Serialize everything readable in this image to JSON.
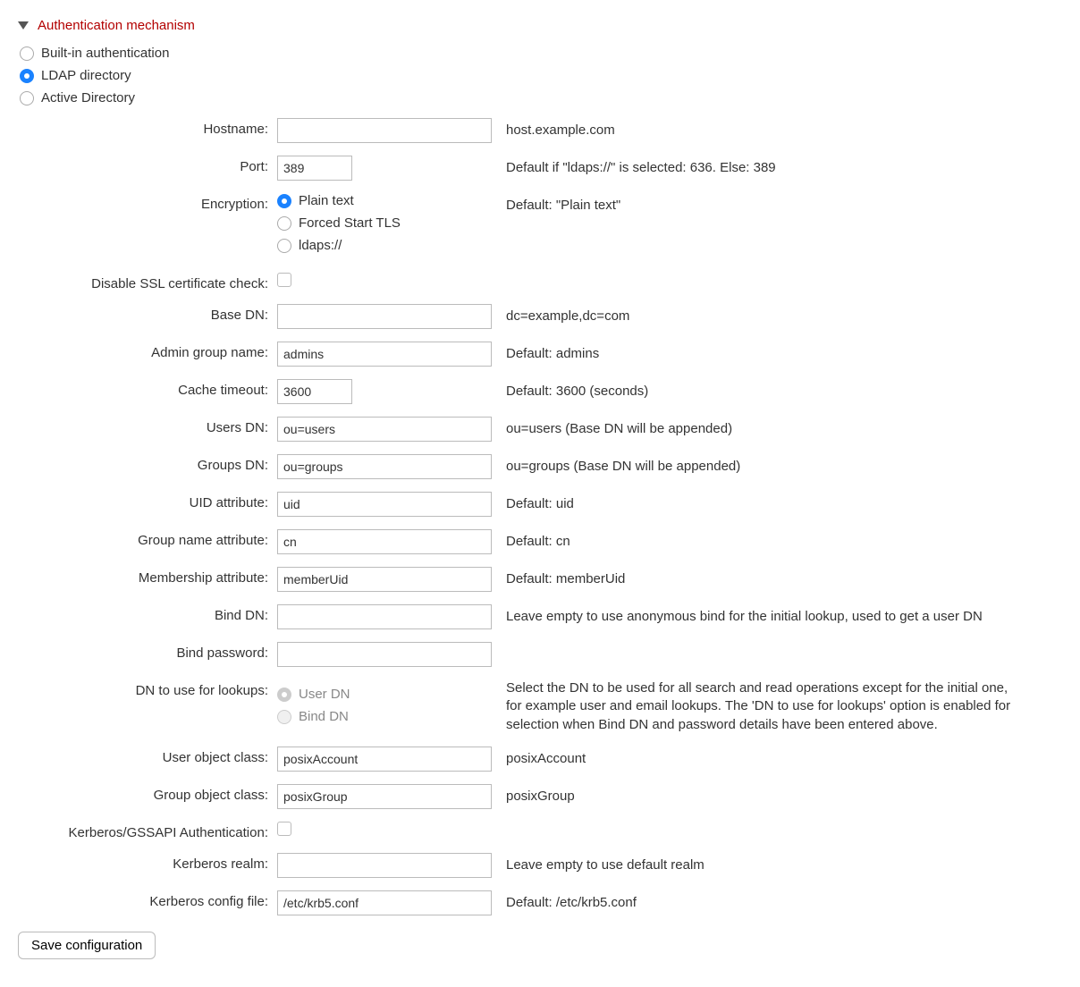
{
  "section": {
    "title": "Authentication mechanism"
  },
  "auth_type": {
    "builtin": "Built-in authentication",
    "ldap": "LDAP directory",
    "ad": "Active Directory",
    "selected": "ldap"
  },
  "labels": {
    "hostname": "Hostname:",
    "port": "Port:",
    "encryption": "Encryption:",
    "disable_ssl": "Disable SSL certificate check:",
    "base_dn": "Base DN:",
    "admin_group": "Admin group name:",
    "cache_timeout": "Cache timeout:",
    "users_dn": "Users DN:",
    "groups_dn": "Groups DN:",
    "uid_attr": "UID attribute:",
    "group_name_attr": "Group name attribute:",
    "membership_attr": "Membership attribute:",
    "bind_dn": "Bind DN:",
    "bind_password": "Bind password:",
    "dn_lookups": "DN to use for lookups:",
    "user_obj_class": "User object class:",
    "group_obj_class": "Group object class:",
    "kerberos_auth": "Kerberos/GSSAPI Authentication:",
    "kerberos_realm": "Kerberos realm:",
    "kerberos_config": "Kerberos config file:"
  },
  "values": {
    "hostname": "",
    "port": "389",
    "base_dn": "",
    "admin_group": "admins",
    "cache_timeout": "3600",
    "users_dn": "ou=users",
    "groups_dn": "ou=groups",
    "uid_attr": "uid",
    "group_name_attr": "cn",
    "membership_attr": "memberUid",
    "bind_dn": "",
    "bind_password": "",
    "user_obj_class": "posixAccount",
    "group_obj_class": "posixGroup",
    "kerberos_realm": "",
    "kerberos_config": "/etc/krb5.conf"
  },
  "encryption": {
    "plain": "Plain text",
    "tls": "Forced Start TLS",
    "ldaps": "ldaps://",
    "selected": "plain"
  },
  "dn_lookup": {
    "user": "User DN",
    "bind": "Bind DN",
    "selected": "user"
  },
  "hints": {
    "hostname": "host.example.com",
    "port": "Default if \"ldaps://\" is selected: 636. Else: 389",
    "encryption": "Default: \"Plain text\"",
    "base_dn": "dc=example,dc=com",
    "admin_group": "Default: admins",
    "cache_timeout": "Default: 3600 (seconds)",
    "users_dn": "ou=users (Base DN will be appended)",
    "groups_dn": "ou=groups (Base DN will be appended)",
    "uid_attr": "Default: uid",
    "group_name_attr": "Default: cn",
    "membership_attr": "Default: memberUid",
    "bind_dn": "Leave empty to use anonymous bind for the initial lookup, used to get a user DN",
    "dn_lookups": "Select the DN to be used for all search and read operations except for the initial one, for example user and email lookups. The 'DN to use for lookups' option is enabled for selection when Bind DN and password details have been entered above.",
    "user_obj_class": "posixAccount",
    "group_obj_class": "posixGroup",
    "kerberos_realm": "Leave empty to use default realm",
    "kerberos_config": "Default: /etc/krb5.conf"
  },
  "buttons": {
    "save": "Save configuration"
  }
}
